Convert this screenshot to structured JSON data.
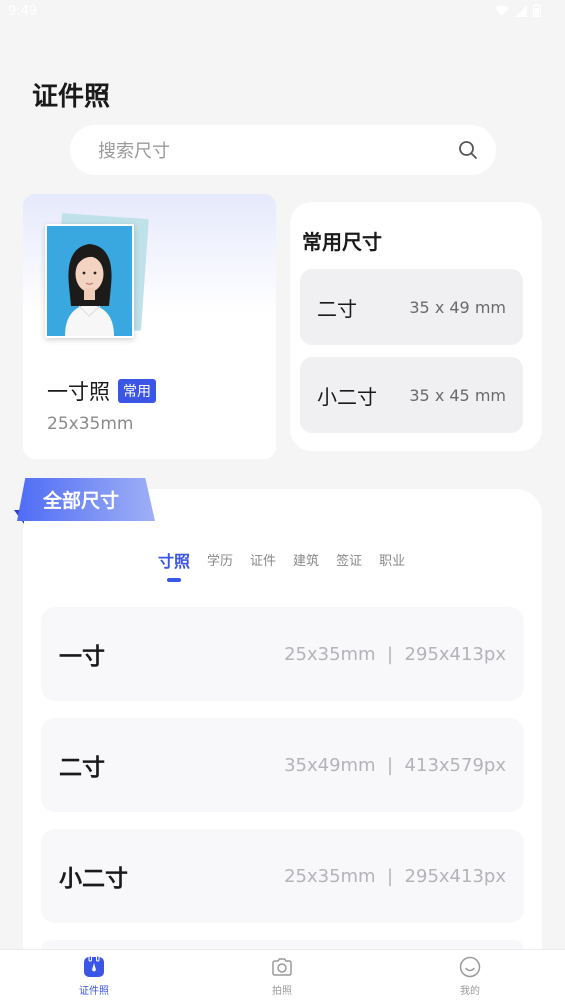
{
  "status_bar": {
    "time": "9:49"
  },
  "header": {
    "title": "证件照"
  },
  "search": {
    "placeholder": "搜索尺寸"
  },
  "featured": {
    "name": "一寸照",
    "badge": "常用",
    "size": "25x35mm"
  },
  "common_sizes": {
    "title": "常用尺寸",
    "items": [
      {
        "name": "二寸",
        "dims": "35 x 49 mm"
      },
      {
        "name": "小二寸",
        "dims": "35 x 45 mm"
      }
    ]
  },
  "all_sizes": {
    "tag": "全部尺寸",
    "tabs": [
      "寸照",
      "学历",
      "证件",
      "建筑",
      "签证",
      "职业"
    ],
    "active_tab": 0,
    "rows": [
      {
        "name": "一寸",
        "dims": "25x35mm  |  295x413px"
      },
      {
        "name": "二寸",
        "dims": "35x49mm  |  413x579px"
      },
      {
        "name": "小二寸",
        "dims": "25x35mm  |  295x413px"
      }
    ]
  },
  "bottom_nav": {
    "items": [
      {
        "label": "证件照",
        "icon": "id-photo-icon",
        "active": true
      },
      {
        "label": "拍照",
        "icon": "camera-icon",
        "active": false
      },
      {
        "label": "我的",
        "icon": "profile-smile-icon",
        "active": false
      }
    ]
  },
  "colors": {
    "accent": "#3b55e6",
    "background": "#f5f5f6"
  }
}
